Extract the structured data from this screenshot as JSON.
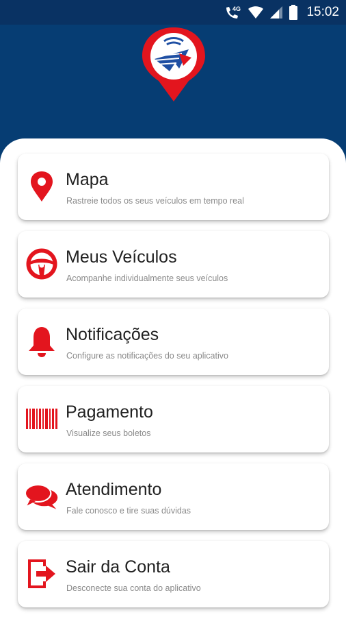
{
  "status_bar": {
    "time": "15:02",
    "network_label": "4G",
    "icons": [
      "wifi-calling-icon",
      "wifi-icon",
      "cell-signal-icon",
      "battery-icon"
    ]
  },
  "header": {
    "logo": "location-pin-logo"
  },
  "colors": {
    "primary": "#063d73",
    "status_bar": "#093263",
    "accent": "#e3151e",
    "title_text": "#212121",
    "subtitle_text": "#8a8a8a"
  },
  "menu": [
    {
      "icon": "map-pin-icon",
      "title": "Mapa",
      "subtitle": "Rastreie todos os seus veículos em tempo real"
    },
    {
      "icon": "steering-wheel-icon",
      "title": "Meus Veículos",
      "subtitle": "Acompanhe individualmente seus veículos"
    },
    {
      "icon": "bell-icon",
      "title": "Notificações",
      "subtitle": "Configure as notificações do seu aplicativo"
    },
    {
      "icon": "barcode-icon",
      "title": "Pagamento",
      "subtitle": "Visualize seus boletos"
    },
    {
      "icon": "chat-icon",
      "title": "Atendimento",
      "subtitle": "Fale conosco e tire suas dúvidas"
    },
    {
      "icon": "logout-icon",
      "title": "Sair da Conta",
      "subtitle": "Desconecte sua conta do aplicativo"
    }
  ]
}
